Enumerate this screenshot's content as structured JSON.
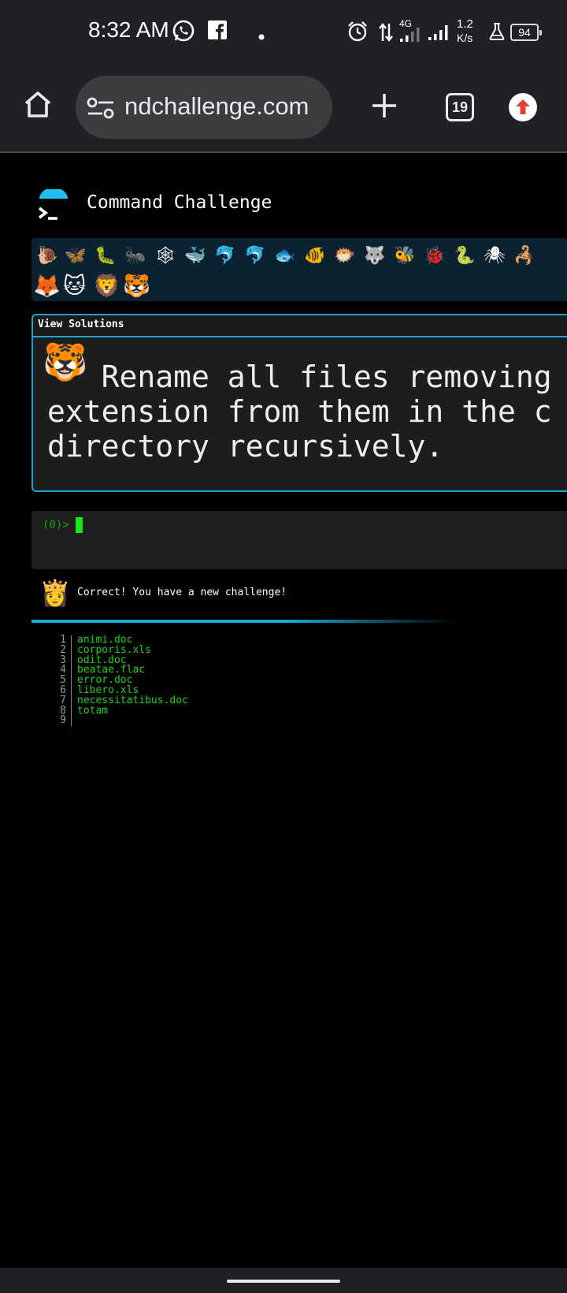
{
  "status_bar": {
    "time": "8:32 AM",
    "network_type": "4G",
    "speed_value": "1.2",
    "speed_unit": "K/s",
    "battery": "94",
    "icons": [
      "whatsapp-icon",
      "facebook-icon",
      "dot-icon",
      "alarm-icon",
      "data-arrows-icon",
      "signal-icon",
      "signal-icon",
      "lab-flask-icon",
      "battery-icon"
    ]
  },
  "browser": {
    "url_text": "ndchallenge.com",
    "tab_count": "19",
    "icons": [
      "home-icon",
      "site-settings-icon",
      "new-tab-plus-icon",
      "tab-switcher-icon",
      "update-arrow-icon"
    ]
  },
  "site": {
    "title": "Command Challenge",
    "emoji_row1": [
      "🐌",
      "🦋",
      "🐛",
      "🐜",
      "🕸",
      "🐳",
      "🐬",
      "🐬",
      "🐟",
      "🐠",
      "🐡",
      "🐺",
      "🐝",
      "🐞",
      "🐍",
      "🕷",
      "🦂"
    ],
    "emoji_row2": [
      "🦊",
      "🐱",
      "🦁",
      "🐯"
    ],
    "challenge": {
      "header": "View Solutions",
      "emoji": "🐯",
      "text_line1": "   Rename all files removing",
      "text_line2": "extension from them in the c",
      "text_line3": "directory recursively."
    },
    "terminal": {
      "prompt": "(0)>"
    },
    "message": {
      "emoji": "👸",
      "text": "Correct! You have a new challenge!"
    },
    "listing": [
      {
        "num": "1",
        "file": "animi.doc"
      },
      {
        "num": "2",
        "file": "corporis.xls"
      },
      {
        "num": "3",
        "file": "odit.doc"
      },
      {
        "num": "4",
        "file": "beatae.flac"
      },
      {
        "num": "5",
        "file": "error.doc"
      },
      {
        "num": "6",
        "file": "libero.xls"
      },
      {
        "num": "7",
        "file": "necessitatibus.doc"
      },
      {
        "num": "8",
        "file": "totam"
      },
      {
        "num": "9",
        "file": ""
      }
    ]
  },
  "colors": {
    "accent": "#1fa3c6",
    "terminal_green": "#19d419",
    "browser_chrome": "#202124"
  }
}
